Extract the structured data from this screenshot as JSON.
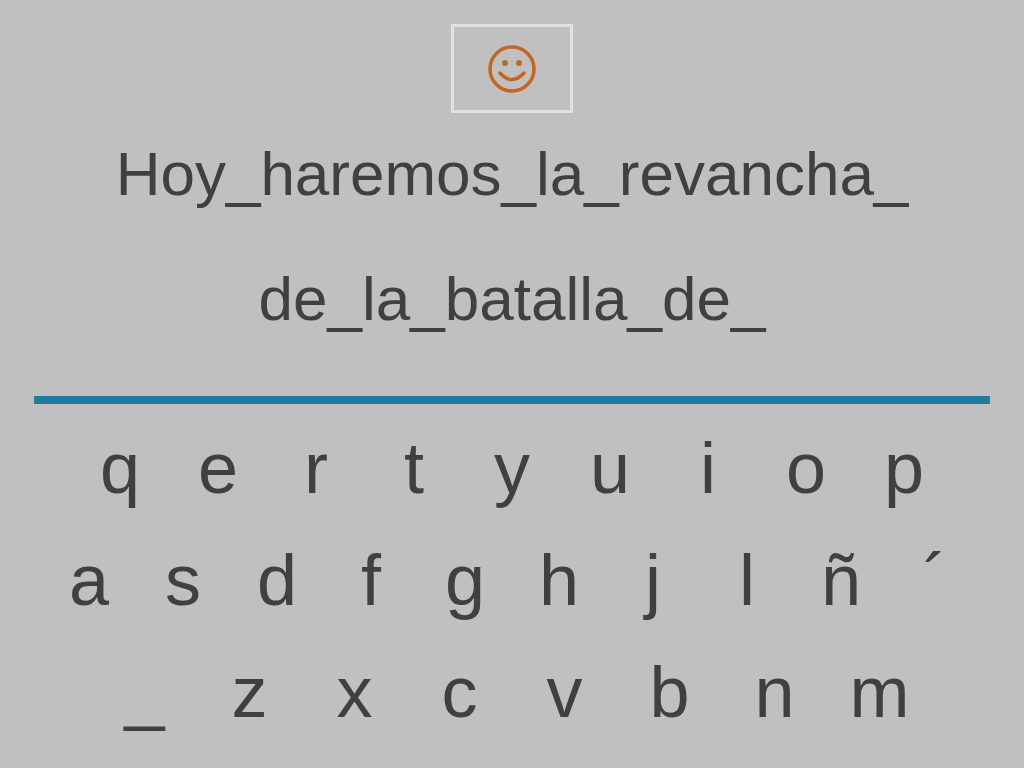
{
  "feedback": {
    "kind": "smiley"
  },
  "sentence": [
    "Hoy_haremos_la_revancha_",
    "de_la_batalla_de_"
  ],
  "keyboard": [
    [
      "q",
      "e",
      "r",
      "t",
      "y",
      "u",
      "i",
      "o",
      "p"
    ],
    [
      "a",
      "s",
      "d",
      "f",
      "g",
      "h",
      "j",
      "l",
      "ñ",
      "´"
    ],
    [
      "_",
      "z",
      "x",
      "c",
      "v",
      "b",
      "n",
      "m"
    ]
  ]
}
